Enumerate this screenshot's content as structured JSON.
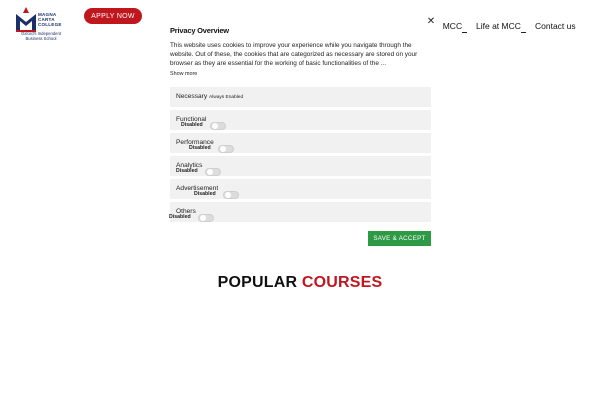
{
  "header": {
    "logo": {
      "line1": "MAGNA",
      "line2": "CARTA",
      "line3": "COLLEGE",
      "tagline": "Oxford's Independent Business School",
      "color": "#1b2f6b",
      "accent": "#c0171e"
    },
    "apply_button": "APPLY NOW",
    "nav": [
      {
        "label": ": MCC"
      },
      {
        "label": "Life at MCC"
      },
      {
        "label": "Contact us"
      }
    ]
  },
  "cookie_modal": {
    "close_icon": "close-icon",
    "title": "Privacy Overview",
    "description": "This website uses cookies to improve your experience while you navigate through the website. Out of these, the cookies that are categorized as necessary are stored on your browser as they are essential for the working of basic functionalities of the ...",
    "show_more": "Show more",
    "categories": [
      {
        "name": "Necessary",
        "badge": "Always Enabled"
      },
      {
        "name": "Functional",
        "status": "Disabled"
      },
      {
        "name": "Performance",
        "status": "Disabled"
      },
      {
        "name": "Analytics",
        "status": "Disabled"
      },
      {
        "name": "Advertisement",
        "status": "Disabled"
      },
      {
        "name": "Others",
        "status": "Disabled"
      }
    ],
    "save_button": "SAVE & ACCEPT",
    "save_color": "#2e9a46"
  },
  "popular": {
    "word1": "POPULAR",
    "word2": "COURSES"
  }
}
